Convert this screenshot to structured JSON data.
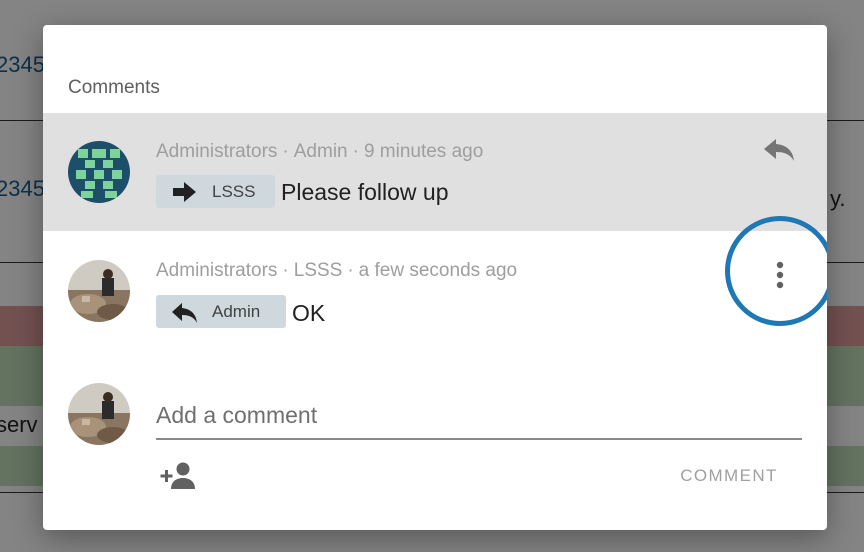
{
  "background": {
    "text_1": "2345",
    "text_2": "2345",
    "text_3": "serv",
    "text_4": "y."
  },
  "dialog": {
    "title": "Comments",
    "comments": [
      {
        "group": "Administrators",
        "author": "Admin",
        "time": "9 minutes ago",
        "chip_direction": "to",
        "chip_label": "LSSS",
        "text": "Please follow up",
        "highlighted": true,
        "action_icon": "reply-icon"
      },
      {
        "group": "Administrators",
        "author": "LSSS",
        "time": "a few seconds ago",
        "chip_direction": "reply",
        "chip_label": "Admin",
        "text": "OK",
        "highlighted": false,
        "action_icon": "more-vert-icon"
      }
    ],
    "composer": {
      "placeholder": "Add a comment",
      "add_user_icon": "person-add-icon",
      "submit_label": "COMMENT"
    }
  },
  "colors": {
    "highlight_row": "#e0e0e0",
    "chip_bg": "#cfd8dc",
    "focus_ring": "#1f78b4",
    "meta_text": "#9e9e9e"
  }
}
